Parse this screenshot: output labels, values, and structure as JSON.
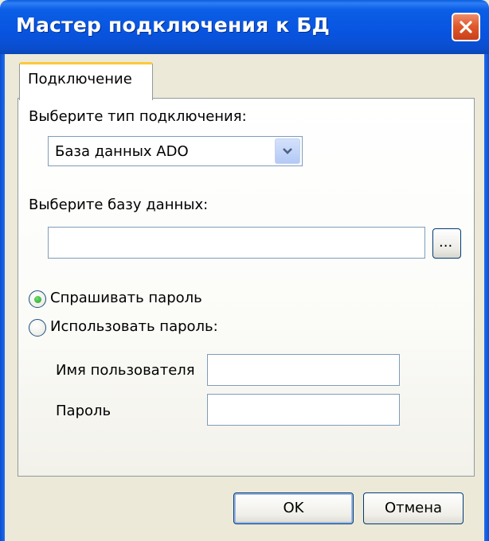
{
  "window": {
    "title": "Мастер подключения к БД"
  },
  "tabs": [
    {
      "label": "Подключение"
    }
  ],
  "connection": {
    "type_label": "Выберите тип подключения:",
    "type_value": "База данных ADO",
    "db_label": "Выберите базу данных:",
    "db_value": "",
    "browse_label": "..."
  },
  "auth": {
    "ask_password_label": "Спрашивать пароль",
    "use_password_label": "Использовать пароль:",
    "selected": "ask_password",
    "username_label": "Имя пользователя",
    "username_value": "",
    "password_label": "Пароль",
    "password_value": ""
  },
  "buttons": {
    "ok": "OK",
    "cancel": "Отмена"
  },
  "colors": {
    "title_bar": "#0a53dd",
    "close": "#e05a2c",
    "tab_accent": "#ffc83c",
    "face": "#ece9d8"
  }
}
